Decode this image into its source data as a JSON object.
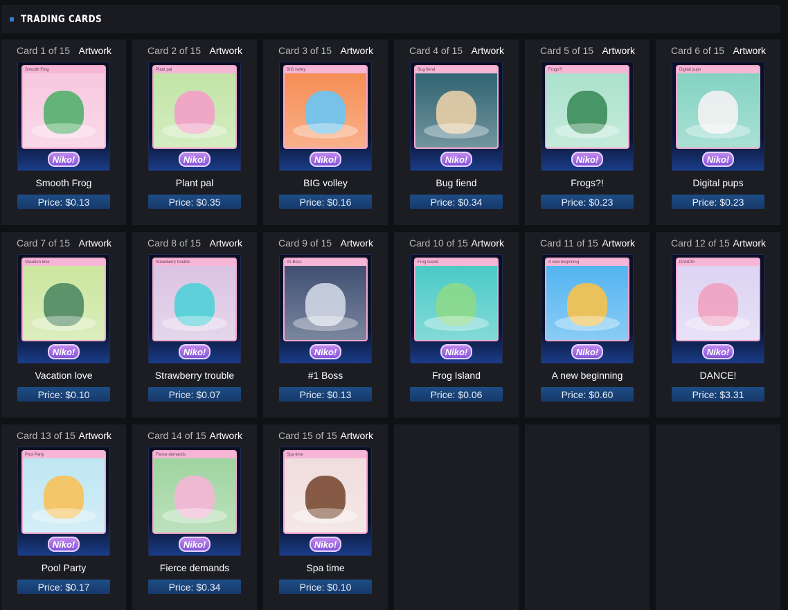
{
  "header": {
    "title": "TRADING CARDS"
  },
  "cards": [
    {
      "num": "Card 1 of 15",
      "type": "Artwork",
      "name": "Smooth Frog",
      "strip": "Smooth Frog",
      "price_label": "Price:",
      "price": "$0.13",
      "bg": "#f7c6de",
      "accent": "#53b06d"
    },
    {
      "num": "Card 2 of 15",
      "type": "Artwork",
      "name": "Plant pal",
      "strip": "Plant pal",
      "price_label": "Price:",
      "price": "$0.35",
      "bg": "#bfe4a3",
      "accent": "#f3a0c8"
    },
    {
      "num": "Card 3 of 15",
      "type": "Artwork",
      "name": "BIG volley",
      "strip": "BIG volley",
      "price_label": "Price:",
      "price": "$0.16",
      "bg": "#f58a4f",
      "accent": "#69c7f5"
    },
    {
      "num": "Card 4 of 15",
      "type": "Artwork",
      "name": "Bug fiend",
      "strip": "Bug fiend",
      "price_label": "Price:",
      "price": "$0.34",
      "bg": "#2b5f6e",
      "accent": "#e8cfa7"
    },
    {
      "num": "Card 5 of 15",
      "type": "Artwork",
      "name": "Frogs?!",
      "strip": "Frogs?!",
      "price_label": "Price:",
      "price": "$0.23",
      "bg": "#a8e0cb",
      "accent": "#3c8c5a"
    },
    {
      "num": "Card 6 of 15",
      "type": "Artwork",
      "name": "Digital pups",
      "strip": "Digital pups",
      "price_label": "Price:",
      "price": "$0.23",
      "bg": "#7fd1c0",
      "accent": "#f2f2f2"
    },
    {
      "num": "Card 7 of 15",
      "type": "Artwork",
      "name": "Vacation love",
      "strip": "Vacation love",
      "price_label": "Price:",
      "price": "$0.10",
      "bg": "#c9e59b",
      "accent": "#4f8a63"
    },
    {
      "num": "Card 8 of 15",
      "type": "Artwork",
      "name": "Strawberry trouble",
      "strip": "Strawberry trouble",
      "price_label": "Price:",
      "price": "$0.07",
      "bg": "#d9c2e2",
      "accent": "#4fd0d8"
    },
    {
      "num": "Card 9 of 15",
      "type": "Artwork",
      "name": "#1 Boss",
      "strip": "#1 Boss",
      "price_label": "Price:",
      "price": "$0.13",
      "bg": "#3a4a6e",
      "accent": "#cfd7e4"
    },
    {
      "num": "Card 10 of 15",
      "type": "Artwork",
      "name": "Frog Island",
      "strip": "Frog Island",
      "price_label": "Price:",
      "price": "$0.06",
      "bg": "#45c8c4",
      "accent": "#8dd98a"
    },
    {
      "num": "Card 11 of 15",
      "type": "Artwork",
      "name": "A new beginning",
      "strip": "A new beginning",
      "price_label": "Price:",
      "price": "$0.60",
      "bg": "#4fb2f0",
      "accent": "#f7c24d"
    },
    {
      "num": "Card 12 of 15",
      "type": "Artwork",
      "name": "DANCE!",
      "strip": "DANCE!",
      "price_label": "Price:",
      "price": "$3.31",
      "bg": "#dcd2f3",
      "accent": "#f0a2c0"
    },
    {
      "num": "Card 13 of 15",
      "type": "Artwork",
      "name": "Pool Party",
      "strip": "Pool Party",
      "price_label": "Price:",
      "price": "$0.17",
      "bg": "#bde6f2",
      "accent": "#f7c25a"
    },
    {
      "num": "Card 14 of 15",
      "type": "Artwork",
      "name": "Fierce demands",
      "strip": "Fierce demands",
      "price_label": "Price:",
      "price": "$0.34",
      "bg": "#9bd39c",
      "accent": "#f4b6d6"
    },
    {
      "num": "Card 15 of 15",
      "type": "Artwork",
      "name": "Spa time",
      "strip": "Spa time",
      "price_label": "Price:",
      "price": "$0.10",
      "bg": "#f0dcdc",
      "accent": "#7a4b34"
    }
  ],
  "logo_text": "Niko!"
}
